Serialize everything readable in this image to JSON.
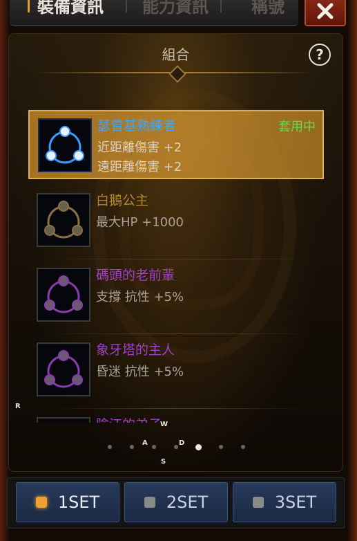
{
  "tabs": [
    {
      "label": "裝備資訊",
      "active": true
    },
    {
      "label": "能力資訊",
      "active": false
    },
    {
      "label": "稱號",
      "active": false
    }
  ],
  "close_icon": "close-x-icon",
  "panel": {
    "title": "組合",
    "help_label": "?"
  },
  "sets": [
    {
      "name": "瑟曾基熟練者",
      "color": "#3aa8ff",
      "icon_color": "#4aa0ff",
      "stats": [
        "近距離傷害 +2",
        "遠距離傷害 +2"
      ],
      "status": "套用中",
      "selected": true
    },
    {
      "name": "白鵝公主",
      "color": "#b08a2a",
      "icon_color": "#8a7040",
      "stats": [
        "最大HP +1000"
      ],
      "status": "",
      "selected": false
    },
    {
      "name": "碼頭的老前輩",
      "color": "#a040c8",
      "icon_color": "#8a3ab0",
      "stats": [
        "支撐 抗性 +5%"
      ],
      "status": "",
      "selected": false
    },
    {
      "name": "象牙塔的主人",
      "color": "#a040c8",
      "icon_color": "#8a3ab0",
      "stats": [
        "昏迷 抗性 +5%"
      ],
      "status": "",
      "selected": false
    },
    {
      "name": "險江的弟子",
      "color": "#a040c8",
      "icon_color": "#8a3ab0",
      "stats": [],
      "status": "",
      "selected": false
    }
  ],
  "pager": {
    "count": 7,
    "active_index": 4
  },
  "key_hints": {
    "r": "R",
    "w": "W",
    "a": "A",
    "d": "D",
    "s": "S"
  },
  "set_buttons": [
    {
      "label": "1SET",
      "active": true
    },
    {
      "label": "2SET",
      "active": false
    },
    {
      "label": "3SET",
      "active": false
    }
  ]
}
